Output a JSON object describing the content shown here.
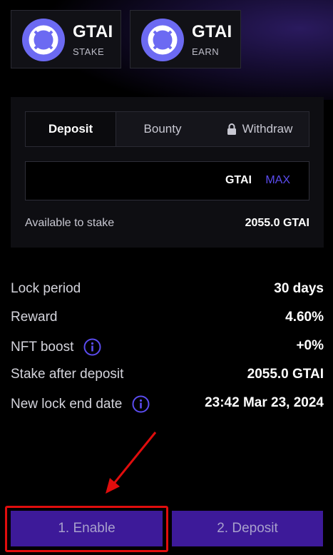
{
  "tokens": {
    "stake": {
      "name": "GTAI",
      "sub": "STAKE",
      "icon": "gtai-logo-icon"
    },
    "earn": {
      "name": "GTAI",
      "sub": "EARN",
      "icon": "gtai-logo-icon"
    }
  },
  "tabs": [
    {
      "label": "Deposit",
      "active": true
    },
    {
      "label": "Bounty",
      "active": false
    },
    {
      "label": "Withdraw",
      "active": false,
      "icon": "lock-icon"
    }
  ],
  "amount": {
    "value": "",
    "placeholder": "",
    "token": "GTAI",
    "max_label": "MAX"
  },
  "available": {
    "label": "Available to stake",
    "value": "2055.0 GTAI"
  },
  "details": [
    {
      "label": "Lock period",
      "value": "30 days"
    },
    {
      "label": "Reward",
      "value": "4.60%"
    },
    {
      "label": "NFT boost",
      "value": "+0%",
      "info_icon": true
    },
    {
      "label": "Stake after deposit",
      "value": "2055.0 GTAI"
    },
    {
      "label": "New lock end date",
      "value": "23:42 Mar 23, 2024",
      "info_icon": true
    }
  ],
  "buttons": {
    "enable": "1. Enable",
    "deposit": "2. Deposit"
  },
  "colors": {
    "accent": "#5b4cf0",
    "button_bg": "#3d1a99",
    "highlight": "#e00d0d",
    "logo": "#6c6af2"
  }
}
